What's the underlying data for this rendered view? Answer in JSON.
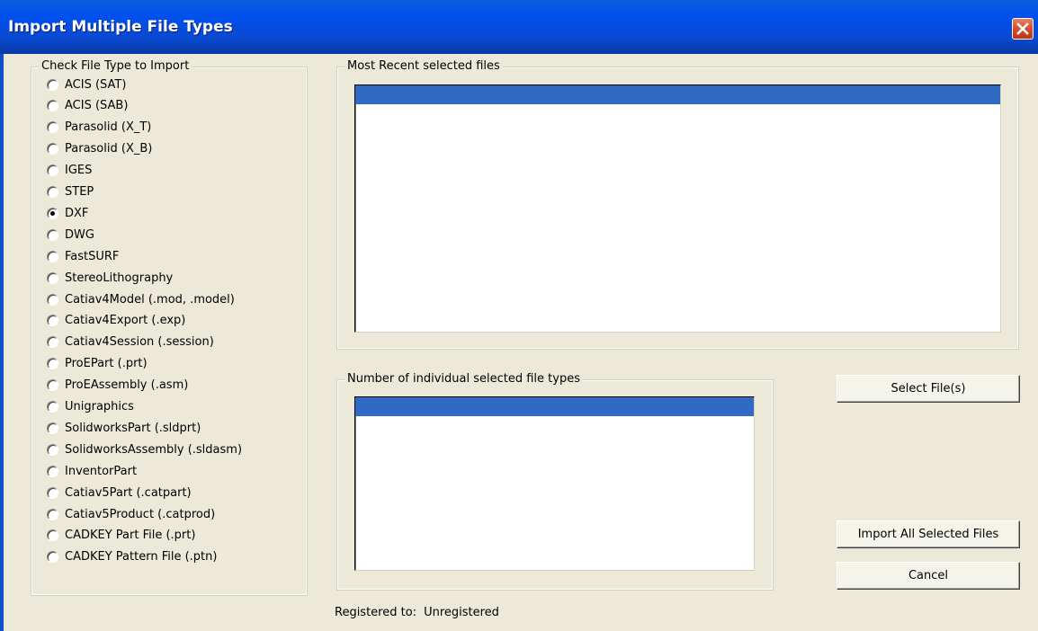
{
  "window": {
    "title": "Import Multiple File Types"
  },
  "file_types": {
    "legend": "Check File Type  to Import",
    "selected": "DXF",
    "options": [
      "ACIS (SAT)",
      "ACIS (SAB)",
      "Parasolid (X_T)",
      "Parasolid (X_B)",
      "IGES",
      "STEP",
      "DXF",
      "DWG",
      "FastSURF",
      "StereoLithography",
      "Catiav4Model (.mod, .model)",
      "Catiav4Export (.exp)",
      "Catiav4Session (.session)",
      "ProEPart (.prt)",
      "ProEAssembly (.asm)",
      "Unigraphics",
      "SolidworksPart (.sldprt)",
      "SolidworksAssembly (.sldasm)",
      "InventorPart",
      "Catiav5Part (.catpart)",
      "Catiav5Product (.catprod)",
      "CADKEY Part File (.prt)",
      "CADKEY Pattern File (.ptn)"
    ]
  },
  "recent_files": {
    "legend": "Most Recent selected files"
  },
  "type_counts": {
    "legend": "Number of individual selected file types"
  },
  "buttons": {
    "select_files": "Select File(s)",
    "import_all": "Import All Selected Files",
    "cancel": "Cancel"
  },
  "status": {
    "label": "Registered to:",
    "value": "Unregistered"
  },
  "colors": {
    "titlebar": "#0054e3",
    "dialog_bg": "#ece9d8",
    "selection": "#316ac5",
    "close_button": "#d8512e"
  }
}
